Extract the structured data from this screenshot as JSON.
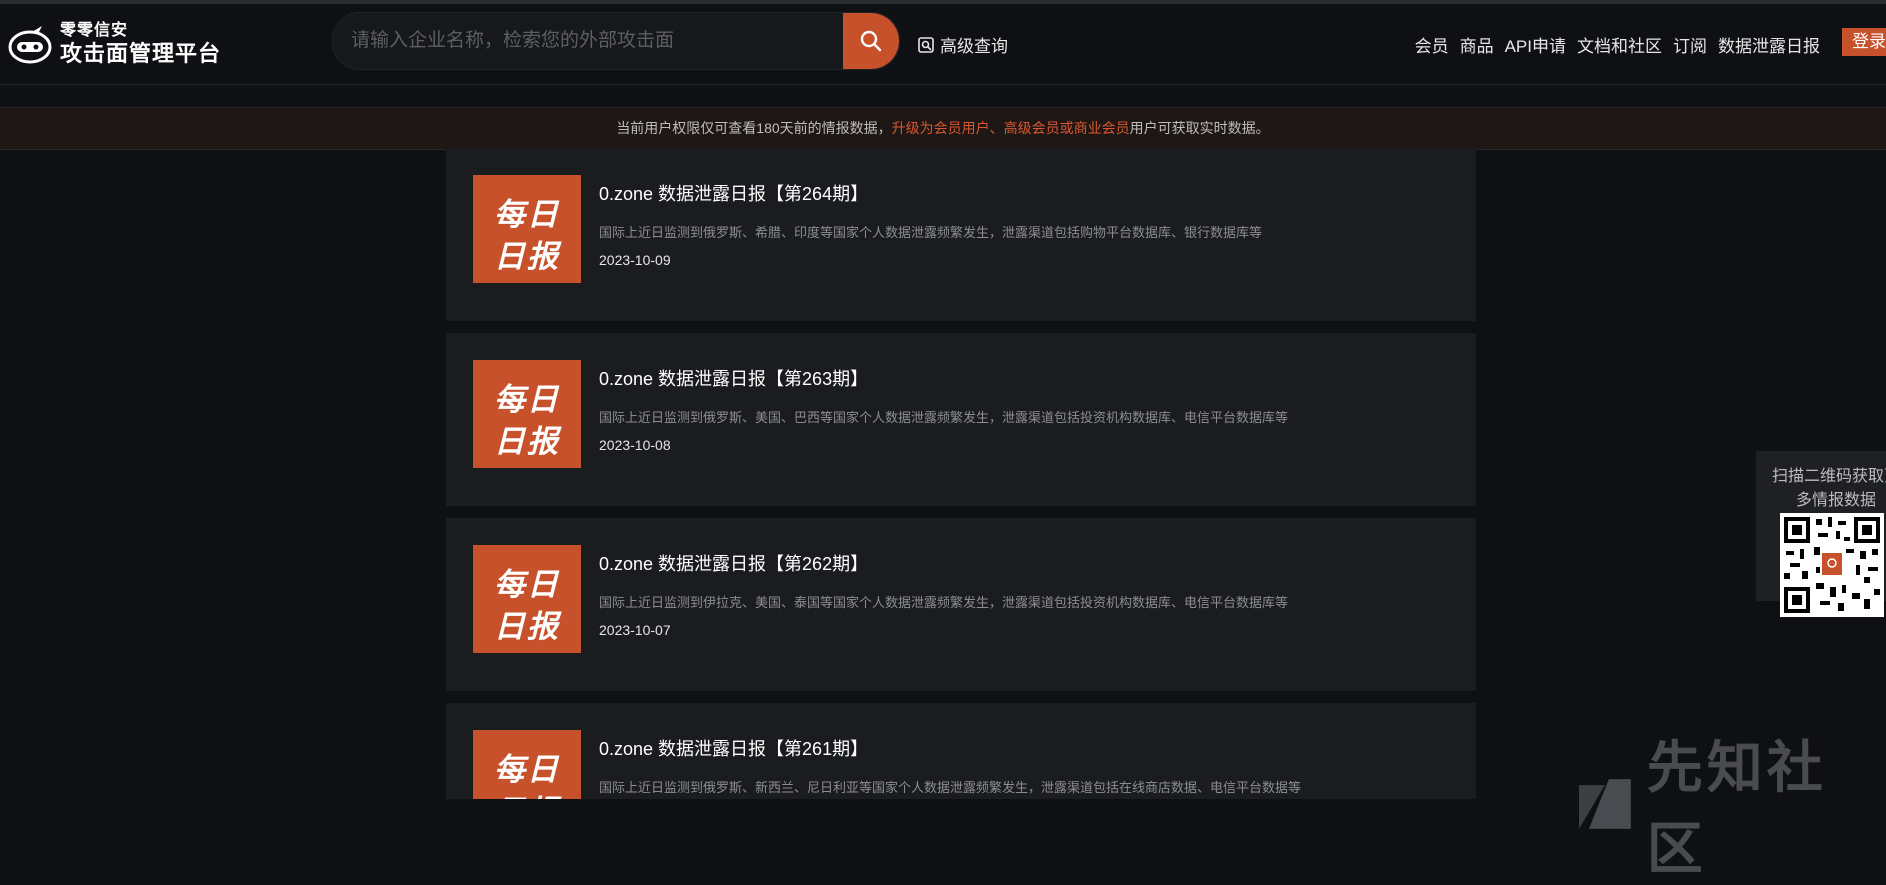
{
  "header": {
    "logo_small": "零零信安",
    "logo_big": "攻击面管理平台",
    "search_placeholder": "请输入企业名称，检索您的外部攻击面",
    "advanced_query": "高级查询",
    "nav": [
      "会员",
      "商品",
      "API申请",
      "文档和社区",
      "订阅",
      "数据泄露日报"
    ],
    "login": "登录"
  },
  "notice": {
    "prefix": "当前用户权限仅可查看180天前的情报数据，",
    "link_upgrade": "升级为会员用户",
    "sep": "、",
    "link_premium": "高级会员或商业会员",
    "suffix": "用户可获取实时数据。"
  },
  "thumb": {
    "line1": "每日",
    "line2": "日报"
  },
  "reports": [
    {
      "title": "0.zone 数据泄露日报【第264期】",
      "desc": "国际上近日监测到俄罗斯、希腊、印度等国家个人数据泄露频繁发生，泄露渠道包括购物平台数据库、银行数据库等",
      "date": "2023-10-09"
    },
    {
      "title": "0.zone 数据泄露日报【第263期】",
      "desc": "国际上近日监测到俄罗斯、美国、巴西等国家个人数据泄露频繁发生，泄露渠道包括投资机构数据库、电信平台数据库等",
      "date": "2023-10-08"
    },
    {
      "title": "0.zone 数据泄露日报【第262期】",
      "desc": "国际上近日监测到伊拉克、美国、泰国等国家个人数据泄露频繁发生，泄露渠道包括投资机构数据库、电信平台数据库等",
      "date": "2023-10-07"
    },
    {
      "title": "0.zone 数据泄露日报【第261期】",
      "desc": "国际上近日监测到俄罗斯、新西兰、尼日利亚等国家个人数据泄露频繁发生，泄露渠道包括在线商店数据、电信平台数据等",
      "date": ""
    }
  ],
  "qr_panel": {
    "text_line1": "扫描二维码获取更",
    "text_line2": "多情报数据"
  },
  "watermark": {
    "text": "先知社区"
  },
  "colors": {
    "accent": "#c6512b",
    "background": "#0f1013",
    "card": "#1b1c20"
  }
}
